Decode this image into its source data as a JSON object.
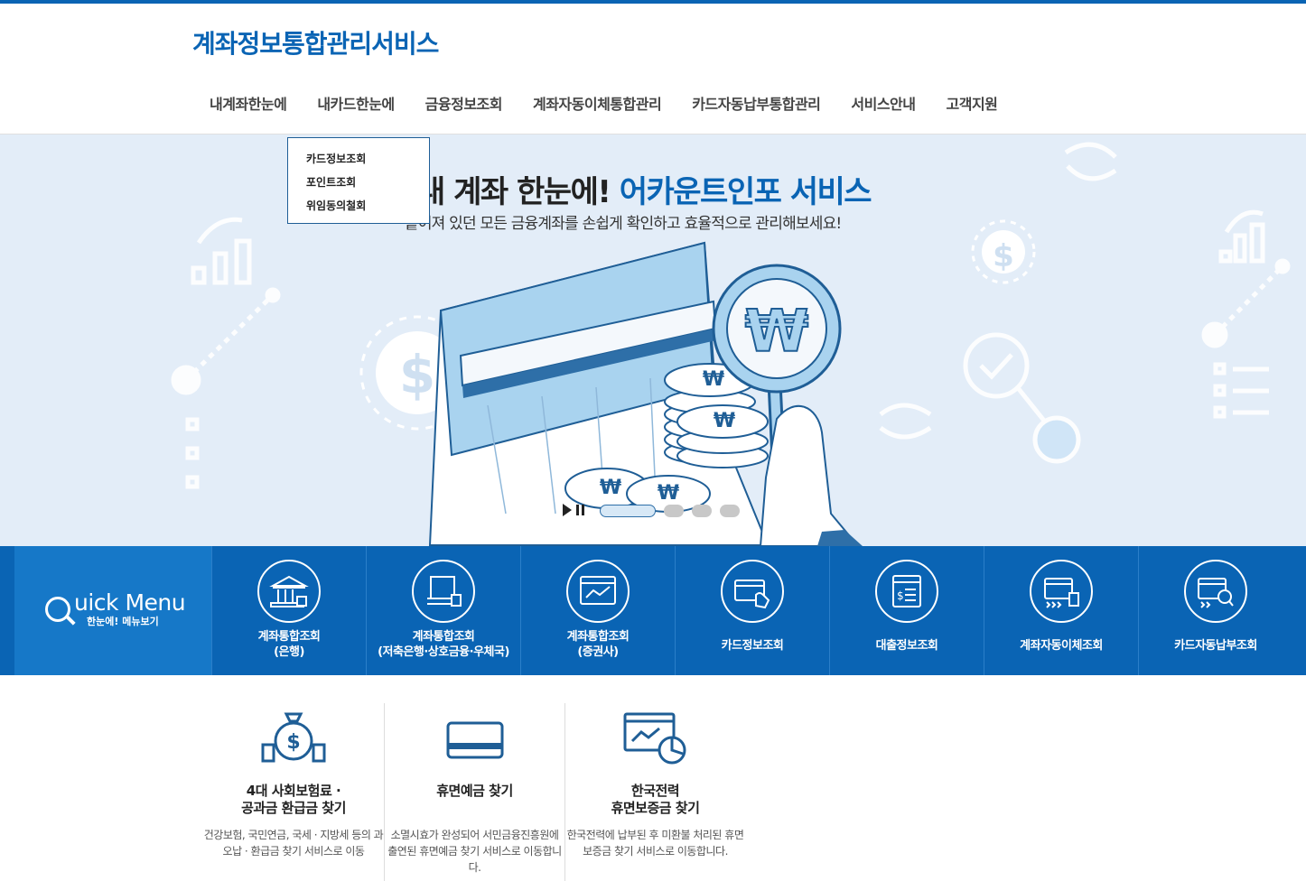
{
  "site": {
    "title": "계좌정보통합관리서비스"
  },
  "nav": {
    "items": [
      {
        "label": "내계좌한눈에"
      },
      {
        "label": "내카드한눈에"
      },
      {
        "label": "금융정보조회"
      },
      {
        "label": "계좌자동이체통합관리"
      },
      {
        "label": "카드자동납부통합관리"
      },
      {
        "label": "서비스안내"
      },
      {
        "label": "고객지원"
      }
    ],
    "dropdown": [
      "카드정보조회",
      "포인트조회",
      "위임동의철회"
    ]
  },
  "hero": {
    "title_plain": "내 계좌 한눈에!",
    "title_accent": "어카운트인포 서비스",
    "subtitle": "흩어져 있던 모든 금융계좌를 손쉽게 확인하고 효율적으로 관리해보세요!",
    "slides_total": 4,
    "slide_active": 1
  },
  "quick_menu": {
    "title": "uick Menu",
    "subtitle": "한눈에! 메뉴보기",
    "items": [
      {
        "line1": "계좌통합조회",
        "line2": "(은행)",
        "icon": "bank-icon"
      },
      {
        "line1": "계좌통합조회",
        "line2": "(저축은행·상호금융·우체국)",
        "icon": "atm-icon"
      },
      {
        "line1": "계좌통합조회",
        "line2": "(증권사)",
        "icon": "stock-chart-icon"
      },
      {
        "line1": "카드정보조회",
        "line2": "",
        "icon": "card-hand-icon"
      },
      {
        "line1": "대출정보조회",
        "line2": "",
        "icon": "loan-document-icon"
      },
      {
        "line1": "계좌자동이체조회",
        "line2": "",
        "icon": "auto-transfer-icon"
      },
      {
        "line1": "카드자동납부조회",
        "line2": "",
        "icon": "card-search-icon"
      }
    ]
  },
  "services": [
    {
      "title": "4대 사회보험료 ·\n공과금 환급금 찾기",
      "desc": "건강보험, 국민연금, 국세 · 지방세 등의 과오납 · 환급금 찾기 서비스로 이동",
      "icon": "money-bag-icon"
    },
    {
      "title": "휴면예금 찾기",
      "desc": "소멸시효가 완성되어 서민금융진흥원에 출연된 휴면예금 찾기 서비스로 이동합니다.",
      "icon": "card-icon"
    },
    {
      "title": "한국전력\n휴면보증금 찾기",
      "desc": "한국전력에 납부된 후 미환불 처리된 휴면보증금 찾기 서비스로 이동합니다.",
      "icon": "report-chart-icon"
    }
  ],
  "colors": {
    "brand": "#0a64b4",
    "quick_title_bg": "#1678c8",
    "hero_bg": "#e3edf8"
  }
}
